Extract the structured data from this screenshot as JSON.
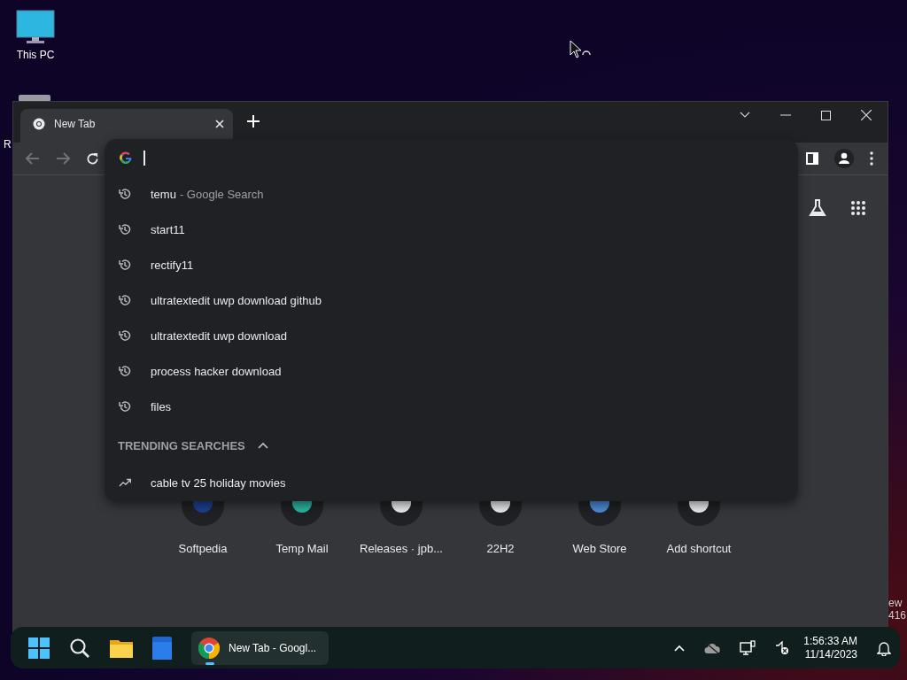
{
  "desktop": {
    "icons": [
      {
        "kind": "pc",
        "label": "This PC"
      },
      {
        "kind": "bin",
        "label": "R"
      }
    ],
    "corner_text": [
      "ew",
      "416"
    ]
  },
  "browser": {
    "tabs": [
      {
        "title": "New Tab",
        "selected": true
      }
    ],
    "suggestions": [
      {
        "kind": "history",
        "text": "temu",
        "detail": "- Google Search"
      },
      {
        "kind": "history",
        "text": "start11"
      },
      {
        "kind": "history",
        "text": "rectify11"
      },
      {
        "kind": "history",
        "text": "ultratextedit uwp download github"
      },
      {
        "kind": "history",
        "text": "ultratextedit uwp download"
      },
      {
        "kind": "history",
        "text": "process hacker download"
      },
      {
        "kind": "history",
        "text": "files"
      }
    ],
    "trending": {
      "heading": "TRENDING SEARCHES",
      "expanded": true,
      "items": [
        {
          "kind": "trending",
          "text": "cable tv 25 holiday movies"
        }
      ]
    },
    "shortcuts": [
      {
        "label": "Softpedia",
        "color": "#1b3f8f"
      },
      {
        "label": "Temp Mail",
        "color": "#2bb3a0"
      },
      {
        "label": "Releases · jpb...",
        "color": "#e8eaed"
      },
      {
        "label": "22H2",
        "color": "#e8eaed"
      },
      {
        "label": "Web Store",
        "color": "#4a8bd6"
      },
      {
        "label": "Add shortcut",
        "color": "#e8eaed"
      }
    ]
  },
  "taskbar": {
    "window_button": {
      "label": "New Tab - Googl...",
      "selected": true
    },
    "clock": {
      "time": "1:56:33 AM",
      "date": "11/14/2023"
    }
  }
}
